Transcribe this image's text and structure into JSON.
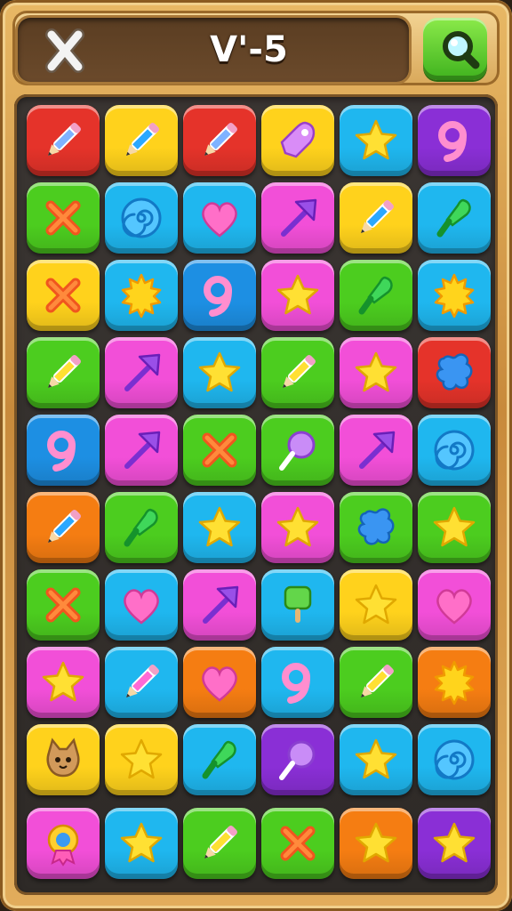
{
  "header": {
    "level_label": "V'-5",
    "close_icon": "close-icon",
    "search_icon": "magnifier-icon"
  },
  "colors": {
    "red": "#e5332a",
    "yellow": "#ffd21c",
    "cyan": "#1fb7ef",
    "purple": "#8a2fd6",
    "green": "#4ccd1f",
    "pink": "#f24fd8",
    "blue": "#1d8fe3",
    "orange": "#f57d12"
  },
  "board": {
    "rows": [
      [
        {
          "color": "red",
          "icon": "pencil"
        },
        {
          "color": "yellow",
          "icon": "pencil"
        },
        {
          "color": "red",
          "icon": "pencil"
        },
        {
          "color": "yellow",
          "icon": "rocket"
        },
        {
          "color": "cyan",
          "icon": "star"
        },
        {
          "color": "purple",
          "icon": "nine"
        }
      ],
      [
        {
          "color": "green",
          "icon": "cross"
        },
        {
          "color": "cyan",
          "icon": "spiral"
        },
        {
          "color": "cyan",
          "icon": "heart"
        },
        {
          "color": "pink",
          "icon": "arrow"
        },
        {
          "color": "yellow",
          "icon": "pencil"
        },
        {
          "color": "cyan",
          "icon": "brush"
        }
      ],
      [
        {
          "color": "yellow",
          "icon": "cross"
        },
        {
          "color": "cyan",
          "icon": "sun"
        },
        {
          "color": "blue",
          "icon": "nine"
        },
        {
          "color": "pink",
          "icon": "star"
        },
        {
          "color": "green",
          "icon": "brush"
        },
        {
          "color": "cyan",
          "icon": "sun"
        }
      ],
      [
        {
          "color": "green",
          "icon": "pencil"
        },
        {
          "color": "pink",
          "icon": "arrow"
        },
        {
          "color": "cyan",
          "icon": "star"
        },
        {
          "color": "green",
          "icon": "pencil"
        },
        {
          "color": "pink",
          "icon": "star"
        },
        {
          "color": "red",
          "icon": "splat"
        }
      ],
      [
        {
          "color": "blue",
          "icon": "nine"
        },
        {
          "color": "pink",
          "icon": "arrow"
        },
        {
          "color": "green",
          "icon": "cross"
        },
        {
          "color": "green",
          "icon": "lollipop"
        },
        {
          "color": "pink",
          "icon": "arrow"
        },
        {
          "color": "cyan",
          "icon": "spiral"
        }
      ],
      [
        {
          "color": "orange",
          "icon": "pencil"
        },
        {
          "color": "green",
          "icon": "brush"
        },
        {
          "color": "cyan",
          "icon": "star"
        },
        {
          "color": "pink",
          "icon": "star"
        },
        {
          "color": "green",
          "icon": "splat"
        },
        {
          "color": "green",
          "icon": "star"
        }
      ],
      [
        {
          "color": "green",
          "icon": "cross"
        },
        {
          "color": "cyan",
          "icon": "heart"
        },
        {
          "color": "pink",
          "icon": "arrow"
        },
        {
          "color": "cyan",
          "icon": "popsicle"
        },
        {
          "color": "yellow",
          "icon": "star"
        },
        {
          "color": "pink",
          "icon": "heart"
        }
      ],
      [
        {
          "color": "pink",
          "icon": "star"
        },
        {
          "color": "cyan",
          "icon": "pencil"
        },
        {
          "color": "orange",
          "icon": "heart"
        },
        {
          "color": "cyan",
          "icon": "nine"
        },
        {
          "color": "green",
          "icon": "pencil"
        },
        {
          "color": "orange",
          "icon": "sun"
        }
      ],
      [
        {
          "color": "yellow",
          "icon": "cat"
        },
        {
          "color": "yellow",
          "icon": "star"
        },
        {
          "color": "cyan",
          "icon": "brush"
        },
        {
          "color": "purple",
          "icon": "lollipop"
        },
        {
          "color": "cyan",
          "icon": "star"
        },
        {
          "color": "cyan",
          "icon": "spiral"
        }
      ],
      [
        {
          "color": "pink",
          "icon": "badge"
        },
        {
          "color": "cyan",
          "icon": "star"
        },
        {
          "color": "green",
          "icon": "pencil"
        },
        {
          "color": "green",
          "icon": "cross"
        },
        {
          "color": "orange",
          "icon": "star"
        },
        {
          "color": "purple",
          "icon": "star"
        }
      ]
    ]
  }
}
